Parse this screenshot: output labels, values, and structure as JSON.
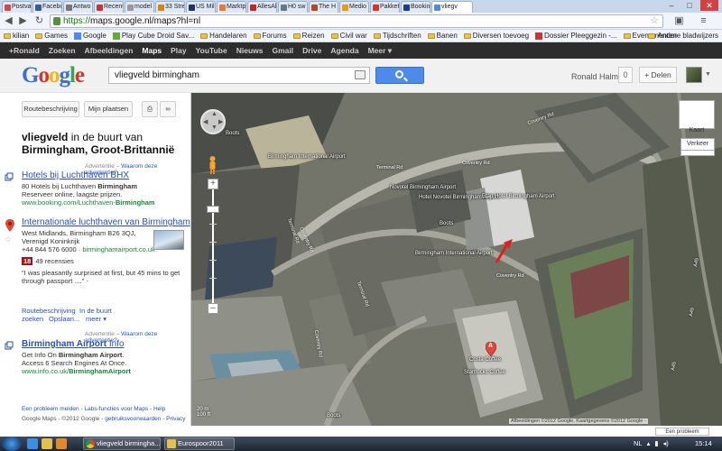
{
  "browser": {
    "tabs": [
      "Postvak",
      "Facebo",
      "Antwo",
      "Recent",
      "model",
      "33 Stre",
      "US Mil",
      "Marktp",
      "AllesAl",
      "H0 sw",
      "The H",
      "Medio",
      "Pakket",
      "Bookin",
      "vliegv"
    ],
    "url": {
      "scheme": "https://",
      "rest": "maps.google.nl/maps?hl=nl"
    },
    "bookmarks": [
      "kilian",
      "Games",
      "Google",
      "Play Cube Droid Sav...",
      "Handelaren",
      "Forums",
      "Reizen",
      "Civil war",
      "Tijdschriften",
      "Banen",
      "Diversen toevoeg",
      "Dossier Pleeggezin -...",
      "Evenementen"
    ],
    "bookmarks_right": "Andere bladwijzers"
  },
  "gbar": {
    "items": [
      "+Ronald",
      "Zoeken",
      "Afbeeldingen",
      "Maps",
      "Play",
      "YouTube",
      "Nieuws",
      "Gmail",
      "Drive",
      "Agenda",
      "Meer"
    ],
    "more_arrow": "▾"
  },
  "header": {
    "logo": [
      "G",
      "o",
      "o",
      "g",
      "l",
      "e"
    ],
    "search_value": "vliegveld birmingham",
    "user_name": "Ronald Halma",
    "notification_count": "0",
    "share_label": "+ Delen"
  },
  "panel": {
    "route_button": "Routebeschrijving",
    "places_button": "Mijn plaatsen",
    "title_bold": "vliegveld",
    "title_rest": " in de buurt van",
    "title_line2": "Birmingham, Groot-Brittannië",
    "ad_label": "Advertentie",
    "ad_why": "Waarom deze advertentie?",
    "ad1": {
      "title": "Hotels bij Luchthaven BHX",
      "line1_pre": "80 Hotels bij Luchthaven ",
      "line1_bold": "Birmingham",
      "line2": "Reserveer online, laagste prijzen.",
      "url_pre": "www.booking.com/Luchthaven-",
      "url_bold": "Birmingham"
    },
    "result": {
      "title": "Internationale luchthaven van Birmingham",
      "address1": "West Midlands, Birmingham B26 3QJ,",
      "address2": "Verenigd Koninkrijk",
      "phone": "+44 844 576 6000",
      "site": "birminghamairport.co.uk",
      "score": "18",
      "reviews": "49 recensies",
      "quote1": "\"I was pleasantly surprised at first, but 45 mins to get",
      "quote2": "through passport ....\"",
      "more": "-"
    },
    "links": {
      "route": "Routebeschrijving",
      "nearby": "In de buurt",
      "search": "zoeken",
      "save": "Opslaan...",
      "meer": "meer"
    },
    "ad2": {
      "title_bold": "Birmingham Airport",
      "title_rest": " Info",
      "line1_pre": "Get Info On ",
      "line1_bold": "Birmingham Airport",
      "line1_end": ".",
      "line2": "Access 6 Search Engines At Once.",
      "url_pre": "www.info.co.uk/",
      "url_bold": "BirminghamAirport"
    },
    "footer": {
      "problem": "Een probleem melden",
      "sep": " - ",
      "labs": "Labs-functies voor Maps",
      "help": "Help",
      "line2_pre": "Google Maps - ©2012 Google - ",
      "terms": "gebruiksvoorwaarden",
      "privacy": "Privacy"
    }
  },
  "map": {
    "labels": [
      "Birmingham International Airport",
      "Novotel Birmingham Airport",
      "Hotel Novotel Birmingham Airport",
      "Etap Hotel Birmingham Airport",
      "Boots",
      "Birmingham International Airport",
      "Costa Coffee",
      "Starbucks Coffee",
      "Boots",
      "Boots"
    ],
    "roads": [
      "Terminal Rd",
      "Terminal Rd",
      "Coventry Rd",
      "Coventry Rd",
      "Coventry Rd",
      "Terminal Rd",
      "Coventry Rd",
      "Coventry Rd",
      "A45",
      "A45",
      "A45"
    ],
    "rotate_label": "Kaart",
    "traffic_label": "Verkeer",
    "scale": [
      "20 m",
      "100 ft"
    ],
    "copyright": "Afbeeldingen ©2012 Google, Kaartgegevens ©2012 Google -",
    "problem": "Een probleem melden",
    "marker": "A"
  },
  "taskbar": {
    "apps": [
      "vliegveld birmingha...",
      "Eurospoor2011"
    ],
    "lang": "NL",
    "time": "15:14"
  }
}
